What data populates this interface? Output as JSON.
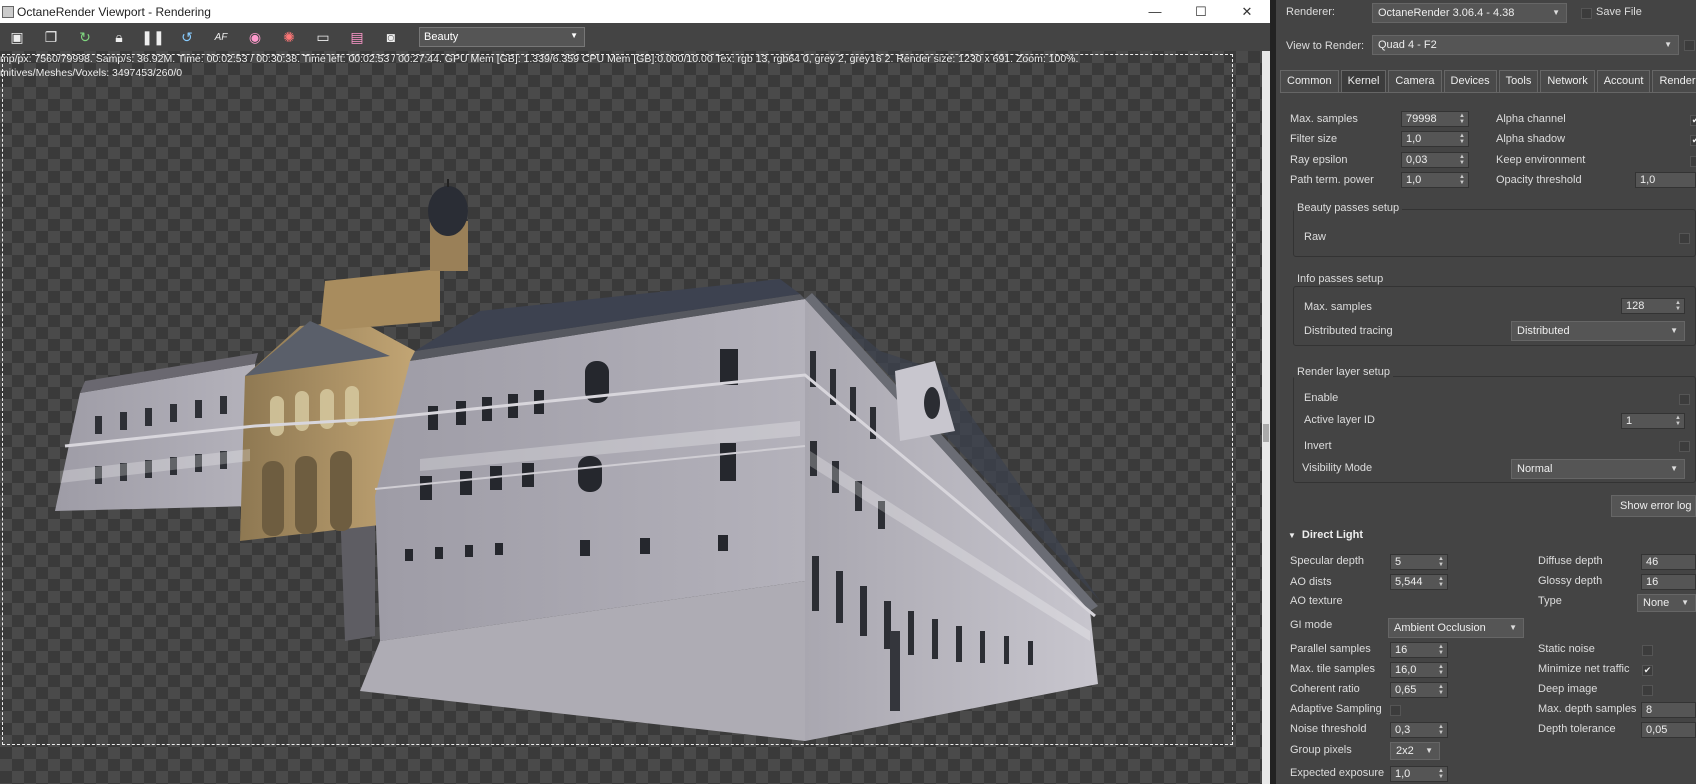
{
  "window": {
    "title": "OctaneRender Viewport - Rendering",
    "minimize": "—",
    "maximize": "☐",
    "close": "✕"
  },
  "toolbar": {
    "icons": [
      "viewport-icon",
      "copy-icon",
      "refresh-icon",
      "lock-icon",
      "pause-icon",
      "restart-icon",
      "af-icon",
      "color-wheel-icon",
      "aperture-icon",
      "monitor-icon",
      "layers-icon",
      "camera-icon"
    ],
    "af_label": "AF",
    "pass": "Beauty"
  },
  "stats": {
    "line1": "mp/px: 7560/79998.   Samp/s: 36.92M.   Time: 00:02:53 / 00:30:38.   Time left: 00:02:53 / 00:27:44.   GPU Mem [GB]: 1.339/6.359   CPU Mem [GB]:0.000/10.00   Tex: rgb 13, rgb64 0, grey 2, grey16 2.   Render size: 1230 x 691.   Zoom: 100%.",
    "line2": "mitives/Meshes/Voxels: 3497453/260/0"
  },
  "panel": {
    "renderer_label": "Renderer:",
    "renderer_value": "OctaneRender 3.06.4 - 4.38",
    "save_file": "Save File",
    "view_label": "View to Render:",
    "view_value": "Quad 4 - F2",
    "tabs": [
      "Common",
      "Kernel",
      "Camera",
      "Devices",
      "Tools",
      "Network",
      "Account",
      "Render Elemen"
    ],
    "active_tab": "Kernel",
    "kernel": {
      "max_samples_label": "Max. samples",
      "max_samples": "79998",
      "filter_size_label": "Filter size",
      "filter_size": "1,0",
      "ray_epsilon_label": "Ray epsilon",
      "ray_epsilon": "0,03",
      "path_term_label": "Path term. power",
      "path_term": "1,0",
      "alpha_channel_label": "Alpha channel",
      "alpha_shadow_label": "Alpha shadow",
      "keep_env_label": "Keep environment",
      "opacity_label": "Opacity threshold",
      "opacity": "1,0"
    },
    "beauty": {
      "title": "Beauty passes setup",
      "raw": "Raw"
    },
    "info": {
      "title": "Info passes setup",
      "max_samples_label": "Max. samples",
      "max_samples": "128",
      "dist_label": "Distributed tracing",
      "dist_value": "Distributed"
    },
    "layer": {
      "title": "Render layer setup",
      "enable": "Enable",
      "active_label": "Active layer ID",
      "active_value": "1",
      "invert": "Invert",
      "vis_label": "Visibility Mode",
      "vis_value": "Normal"
    },
    "show_error_log": "Show error log",
    "direct_light": {
      "title": "Direct Light",
      "spec_depth_label": "Specular depth",
      "spec_depth": "5",
      "diff_depth_label": "Diffuse depth",
      "diff_depth": "46",
      "ao_dist_label": "AO dists",
      "ao_dist": "5,544",
      "glossy_label": "Glossy depth",
      "glossy": "16",
      "ao_tex_label": "AO texture",
      "type_label": "Type",
      "type_value": "None",
      "gi_label": "GI mode",
      "gi_value": "Ambient Occlusion",
      "parallel_label": "Parallel samples",
      "parallel": "16",
      "static_noise_label": "Static noise",
      "max_tile_label": "Max. tile samples",
      "max_tile": "16,0",
      "min_net_label": "Minimize net traffic",
      "coherent_label": "Coherent ratio",
      "coherent": "0,65",
      "deep_label": "Deep image",
      "adaptive_label": "Adaptive Sampling",
      "max_depth_label": "Max. depth samples",
      "max_depth": "8",
      "noise_label": "Noise threshold",
      "noise": "0,3",
      "depth_tol_label": "Depth tolerance",
      "depth_tol": "0,05",
      "group_label": "Group pixels",
      "group_value": "2x2",
      "exposure_label": "Expected exposure",
      "exposure": "1,0"
    }
  },
  "colors": {
    "bg": "#444444",
    "checker": "#4a4a4a",
    "building": "#a8a6ad",
    "church": "#b89a6a"
  }
}
